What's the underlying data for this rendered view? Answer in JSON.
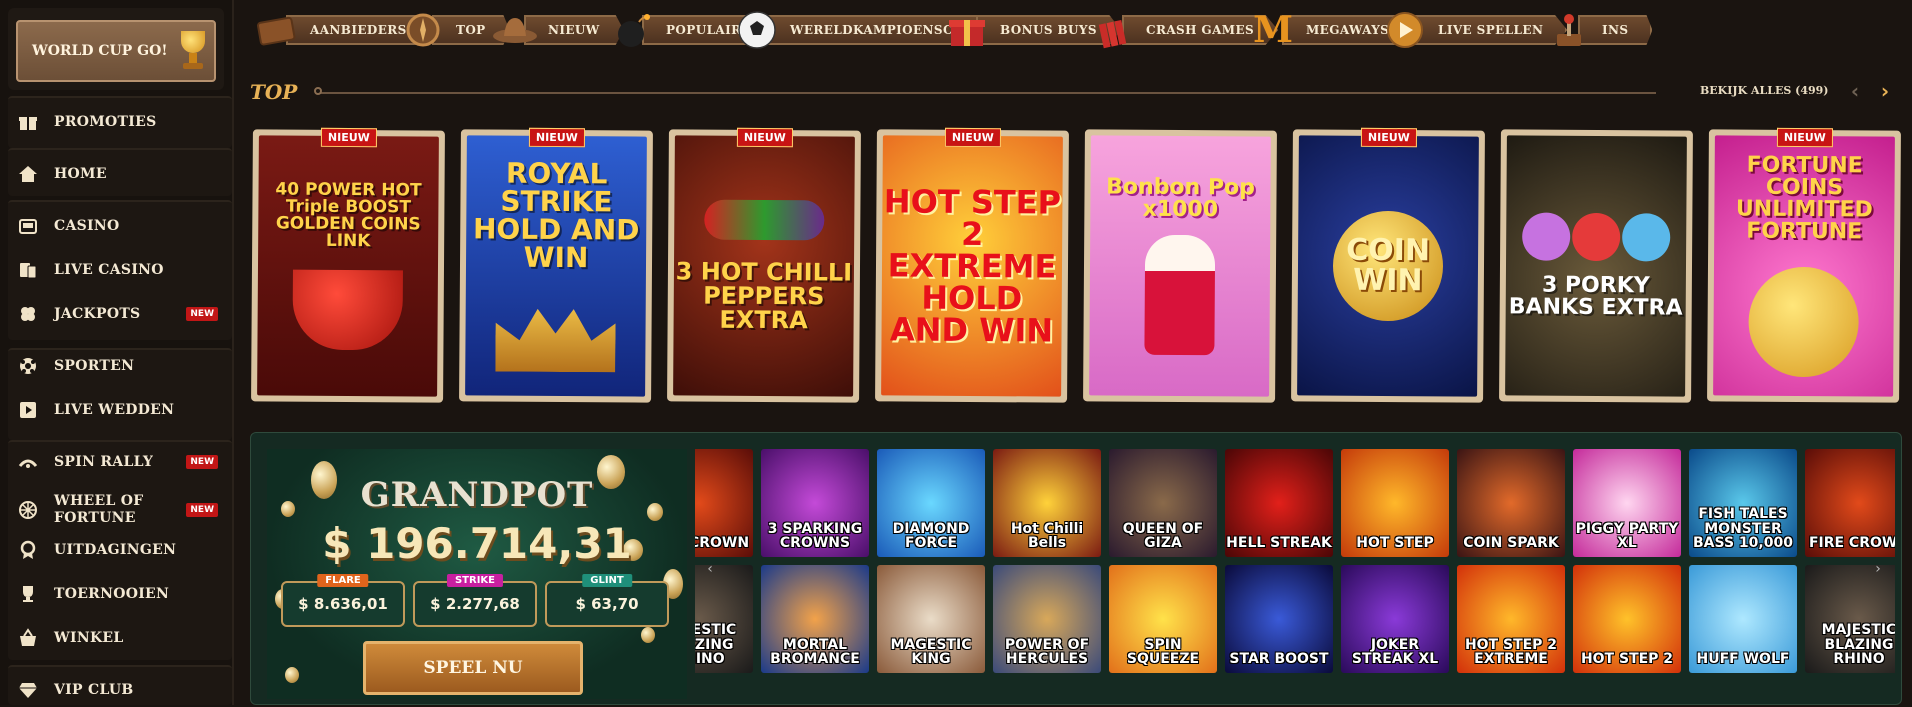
{
  "sidebar": {
    "world_cup": "WORLD CUP GO!",
    "items": [
      {
        "label": "PROMOTIES",
        "icon": "gift-icon"
      },
      {
        "label": "HOME",
        "icon": "home-icon"
      },
      {
        "label": "CASINO",
        "icon": "casino-icon"
      },
      {
        "label": "LIVE CASINO",
        "icon": "live-casino-icon"
      },
      {
        "label": "JACKPOTS",
        "icon": "clover-icon",
        "badge": "NEW"
      },
      {
        "label": "SPORTEN",
        "icon": "soccer-ball-icon"
      },
      {
        "label": "LIVE WEDDEN",
        "icon": "play-icon"
      },
      {
        "label": "SPIN RALLY",
        "icon": "rally-icon",
        "badge": "NEW"
      },
      {
        "label": "WHEEL OF FORTUNE",
        "icon": "wheel-icon",
        "badge": "NEW"
      },
      {
        "label": "UITDAGINGEN",
        "icon": "medal-icon"
      },
      {
        "label": "TOERNOOIEN",
        "icon": "trophy-icon"
      },
      {
        "label": "WINKEL",
        "icon": "basket-icon"
      },
      {
        "label": "VIP CLUB",
        "icon": "diamond-icon"
      }
    ]
  },
  "categories": [
    "AANBIEDERS",
    "TOP",
    "NIEUW",
    "POPULAIR",
    "WERELDKAMPIOENSCHAP",
    "BONUS BUYS",
    "CRASH GAMES",
    "MEGAWAYS",
    "LIVE SPELLEN",
    "INS"
  ],
  "top_section": {
    "title": "TOP",
    "view_all": "BEKIJK ALLES (499)",
    "new_badge": "NIEUW",
    "games": [
      {
        "name": "40 POWER HOT Triple BOOST GOLDEN COINS LINK",
        "new": true
      },
      {
        "name": "ROYAL STRIKE HOLD AND WIN",
        "new": true
      },
      {
        "name": "3 HOT CHILLI PEPPERS EXTRA",
        "new": true
      },
      {
        "name": "HOT STEP 2 EXTREME HOLD AND WIN",
        "new": true
      },
      {
        "name": "Bonbon Pop x1000",
        "new": false
      },
      {
        "name": "COIN WIN",
        "new": true
      },
      {
        "name": "3 PORKY BANKS EXTRA",
        "new": false
      },
      {
        "name": "FORTUNE COINS UNLIMITED FORTUNE",
        "new": true
      }
    ]
  },
  "jackpot": {
    "title": "GRANDPOT",
    "amount": "$ 196.714,31",
    "tiers": [
      {
        "label": "FLARE",
        "value": "$ 8.636,01",
        "color": "#e0641c"
      },
      {
        "label": "STRIKE",
        "value": "$ 2.277,68",
        "color": "#c81fa0"
      },
      {
        "label": "GLINT",
        "value": "$ 63,70",
        "color": "#1f8f7a"
      }
    ],
    "cta": "SPEEL NU"
  },
  "tiles_row1": [
    "FIRE CROWN",
    "3 SPARKING CROWNS",
    "DIAMOND FORCE",
    "Hot Chilli Bells",
    "QUEEN OF GIZA",
    "HELL STREAK",
    "HOT STEP",
    "COIN SPARK",
    "PIGGY PARTY XL",
    "FISH TALES MONSTER BASS 10,000",
    "FIRE CROWN"
  ],
  "tiles_row2": [
    "MAJESTIC BLAZING RHINO",
    "MORTAL BROMANCE",
    "MAGESTIC KING",
    "POWER OF HERCULES",
    "SPIN SQUEEZE",
    "STAR BOOST",
    "JOKER STREAK XL",
    "HOT STEP 2 EXTREME",
    "HOT STEP 2",
    "HUFF WOLF",
    "MAJESTIC BLAZING RHINO"
  ]
}
